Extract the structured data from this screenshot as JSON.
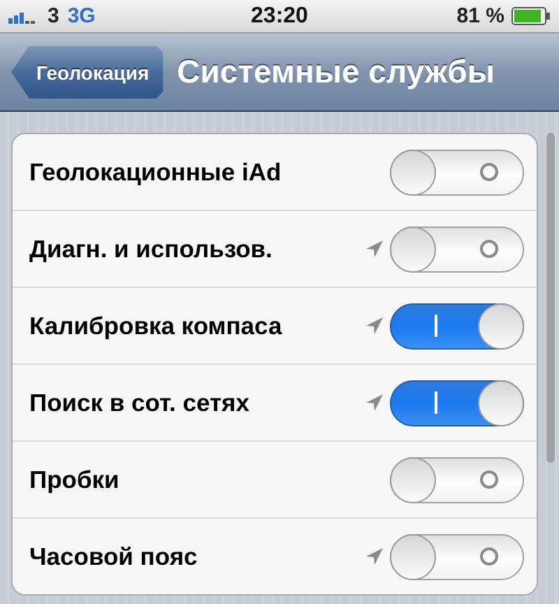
{
  "status_bar": {
    "carrier": "3",
    "network": "3G",
    "time": "23:20",
    "battery": "81 %"
  },
  "nav_bar": {
    "back": "Геолокация",
    "title": "Системные службы"
  },
  "settings": [
    {
      "label": "Геолокационные iAd",
      "location_used": false,
      "on": false
    },
    {
      "label": "Диагн. и использов.",
      "location_used": true,
      "on": false
    },
    {
      "label": "Калибровка компаса",
      "location_used": true,
      "on": true
    },
    {
      "label": "Поиск в сот. сетях",
      "location_used": true,
      "on": true
    },
    {
      "label": "Пробки",
      "location_used": false,
      "on": false
    },
    {
      "label": "Часовой пояс",
      "location_used": true,
      "on": false
    }
  ]
}
